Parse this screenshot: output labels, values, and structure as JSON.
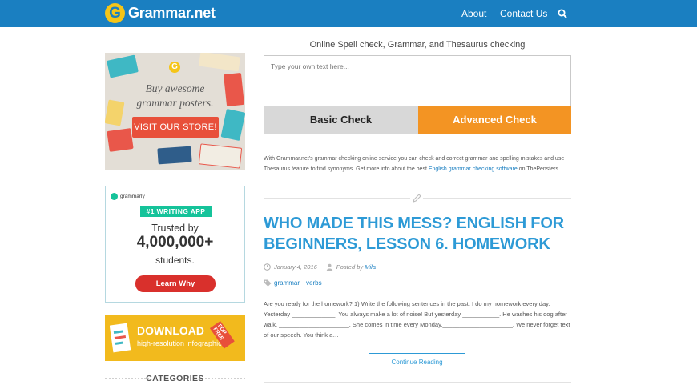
{
  "header": {
    "logo_letter": "G",
    "logo_text": "Grammar.net",
    "nav": [
      {
        "label": "About"
      },
      {
        "label": "Contact Us"
      }
    ],
    "search_icon": "search-icon",
    "bar_color": "#1a7fc1"
  },
  "sidebar": {
    "poster": {
      "logo_letter": "G",
      "line1": "Buy awesome",
      "line2": "grammar posters.",
      "button": "VISIT OUR STORE!"
    },
    "grammarly": {
      "brand": "grammarly",
      "badge": "#1 WRITING APP",
      "trusted": "Trusted by",
      "count": "4,000,000+",
      "students": "students.",
      "button": "Learn Why"
    },
    "download": {
      "title": "DOWNLOAD",
      "subtitle": "high-resolution infographics",
      "corner": "FOR FREE"
    },
    "categories_heading": "CATEGORIES"
  },
  "checker": {
    "heading": "Online Spell check, Grammar, and Thesaurus checking",
    "placeholder": "Type your own text here...",
    "basic_button": "Basic Check",
    "advanced_button": "Advanced Check",
    "description_pre": "With Grammar.net's grammar checking online service you can check and correct grammar and spelling mistakes and use Thesaurus feature to find synonyms. Get more info about the best ",
    "description_link": "English grammar checking software",
    "description_post": " on ThePensters."
  },
  "post": {
    "title_line1": "WHO MADE THIS MESS? ENGLISH FOR",
    "title_line2": "BEGINNERS, LESSON 6. HOMEWORK",
    "date": "January 4, 2016",
    "posted_by": "Posted by",
    "author": "Mila",
    "tags": [
      "grammar",
      "verbs"
    ],
    "excerpt": "Are you ready for the homework? 1) Write the following sentences in the past: I do my homework every day. Yesterday _____________. You always make a lot of noise! But yesterday ___________. He washes his dog after walk. _____________________. She comes in time every Monday._____________________. We never forget text of our speech. You think a…",
    "continue": "Continue Reading"
  }
}
